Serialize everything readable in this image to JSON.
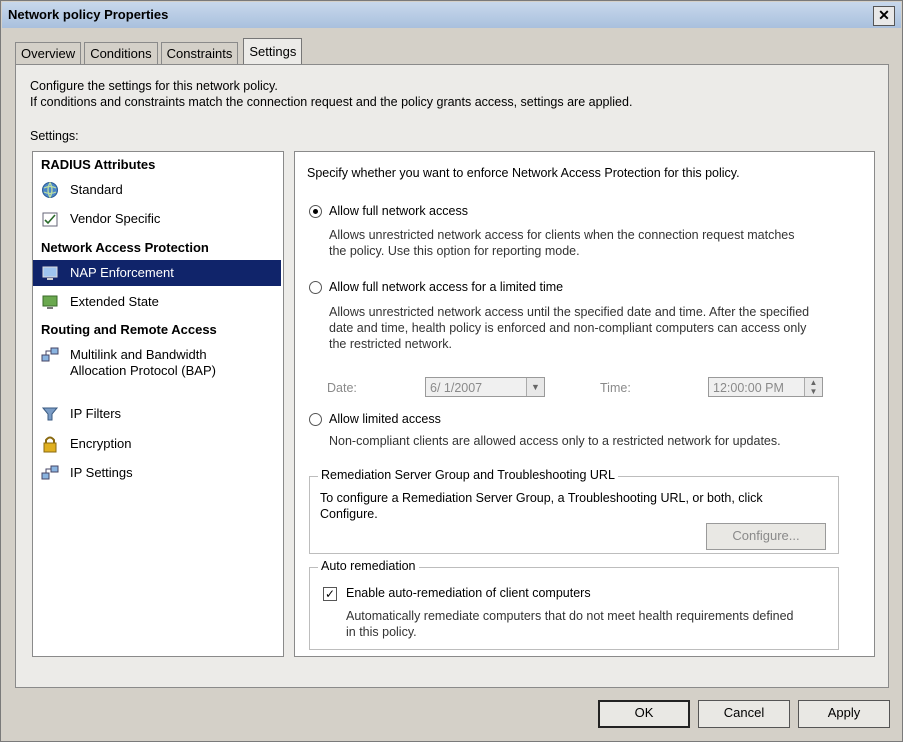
{
  "window": {
    "title": "Network policy Properties",
    "close_glyph": "✕"
  },
  "tabs": [
    {
      "label": "Overview"
    },
    {
      "label": "Conditions"
    },
    {
      "label": "Constraints"
    },
    {
      "label": "Settings",
      "active": true
    }
  ],
  "panel": {
    "desc_line1": "Configure the settings for this network policy.",
    "desc_line2": "If conditions and constraints match the connection request and the policy grants access, settings are applied.",
    "settings_label": "Settings:"
  },
  "tree": {
    "headings": [
      "RADIUS Attributes",
      "Network Access Protection",
      "Routing and Remote Access"
    ],
    "items": [
      {
        "label": "Standard",
        "icon": "globe-icon"
      },
      {
        "label": "Vendor Specific",
        "icon": "checklist-icon"
      },
      {
        "label": "NAP Enforcement",
        "icon": "monitor-icon",
        "selected": true
      },
      {
        "label": "Extended State",
        "icon": "state-icon"
      },
      {
        "label": "Multilink and Bandwidth",
        "label2": "Allocation Protocol (BAP)",
        "icon": "network-icon"
      },
      {
        "label": "IP Filters",
        "icon": "filter-icon"
      },
      {
        "label": "Encryption",
        "icon": "lock-icon"
      },
      {
        "label": "IP Settings",
        "icon": "network-icon"
      }
    ]
  },
  "nap": {
    "prompt": "Specify whether you want to enforce Network Access Protection for this policy.",
    "opt1": {
      "label": "Allow full network access",
      "desc1": "Allows unrestricted network access for clients when the connection request matches",
      "desc2": "the policy.  Use this option for reporting mode.",
      "checked": true
    },
    "opt2": {
      "label": "Allow full network access for a limited time",
      "desc1": "Allows unrestricted network access until the specified date and time. After the specified",
      "desc2": "date and time, health policy is enforced and non-compliant computers can access only",
      "desc3": "the restricted network.",
      "date_label": "Date:",
      "date_value": "6/ 1/2007",
      "time_label": "Time:",
      "time_value": "12:00:00 PM"
    },
    "opt3": {
      "label": "Allow limited access",
      "desc1": "Non-compliant clients are allowed access only to a restricted network for updates."
    },
    "remediation": {
      "title": "Remediation Server Group and Troubleshooting URL",
      "text1": "To configure a Remediation Server Group, a Troubleshooting URL, or both, click",
      "text2": "Configure.",
      "button": "Configure..."
    },
    "auto": {
      "title": "Auto remediation",
      "checkbox_label": "Enable auto-remediation of client computers",
      "checked": true,
      "desc1": "Automatically remediate computers that do not meet health requirements defined",
      "desc2": "in this policy."
    }
  },
  "footer": {
    "ok": "OK",
    "cancel": "Cancel",
    "apply": "Apply"
  }
}
